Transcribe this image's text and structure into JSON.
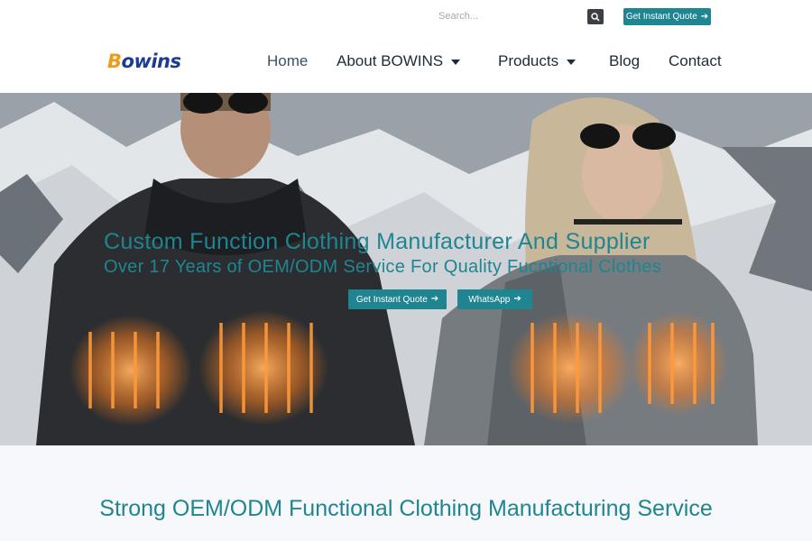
{
  "topbar": {
    "search_placeholder": "Search...",
    "quote_label": "Get Instant Quote",
    "quote_icon": "arrow-right-icon"
  },
  "nav": {
    "logo_b": "B",
    "logo_rest": "owins",
    "items": [
      {
        "label": "Home",
        "active": true
      },
      {
        "label": "About BOWINS",
        "dropdown": true
      },
      {
        "label": "Products",
        "dropdown": true
      },
      {
        "label": "Blog"
      },
      {
        "label": "Contact"
      }
    ]
  },
  "hero": {
    "title": "Custom Function Clothing Manufacturer And Supplier",
    "subtitle": "Over 17 Years of OEM/ODM Service For Quality Fucntional Clothes",
    "quote_button": "Get Instant Quote",
    "whatsapp_button": "WhatsApp"
  },
  "section": {
    "title": "Strong OEM/ODM Functional Clothing Manufacturing Service"
  },
  "colors": {
    "accent": "#1f8591",
    "logo_blue": "#1a3d8f",
    "logo_orange": "#f09a1a",
    "nav_text": "#1d2b3a"
  }
}
